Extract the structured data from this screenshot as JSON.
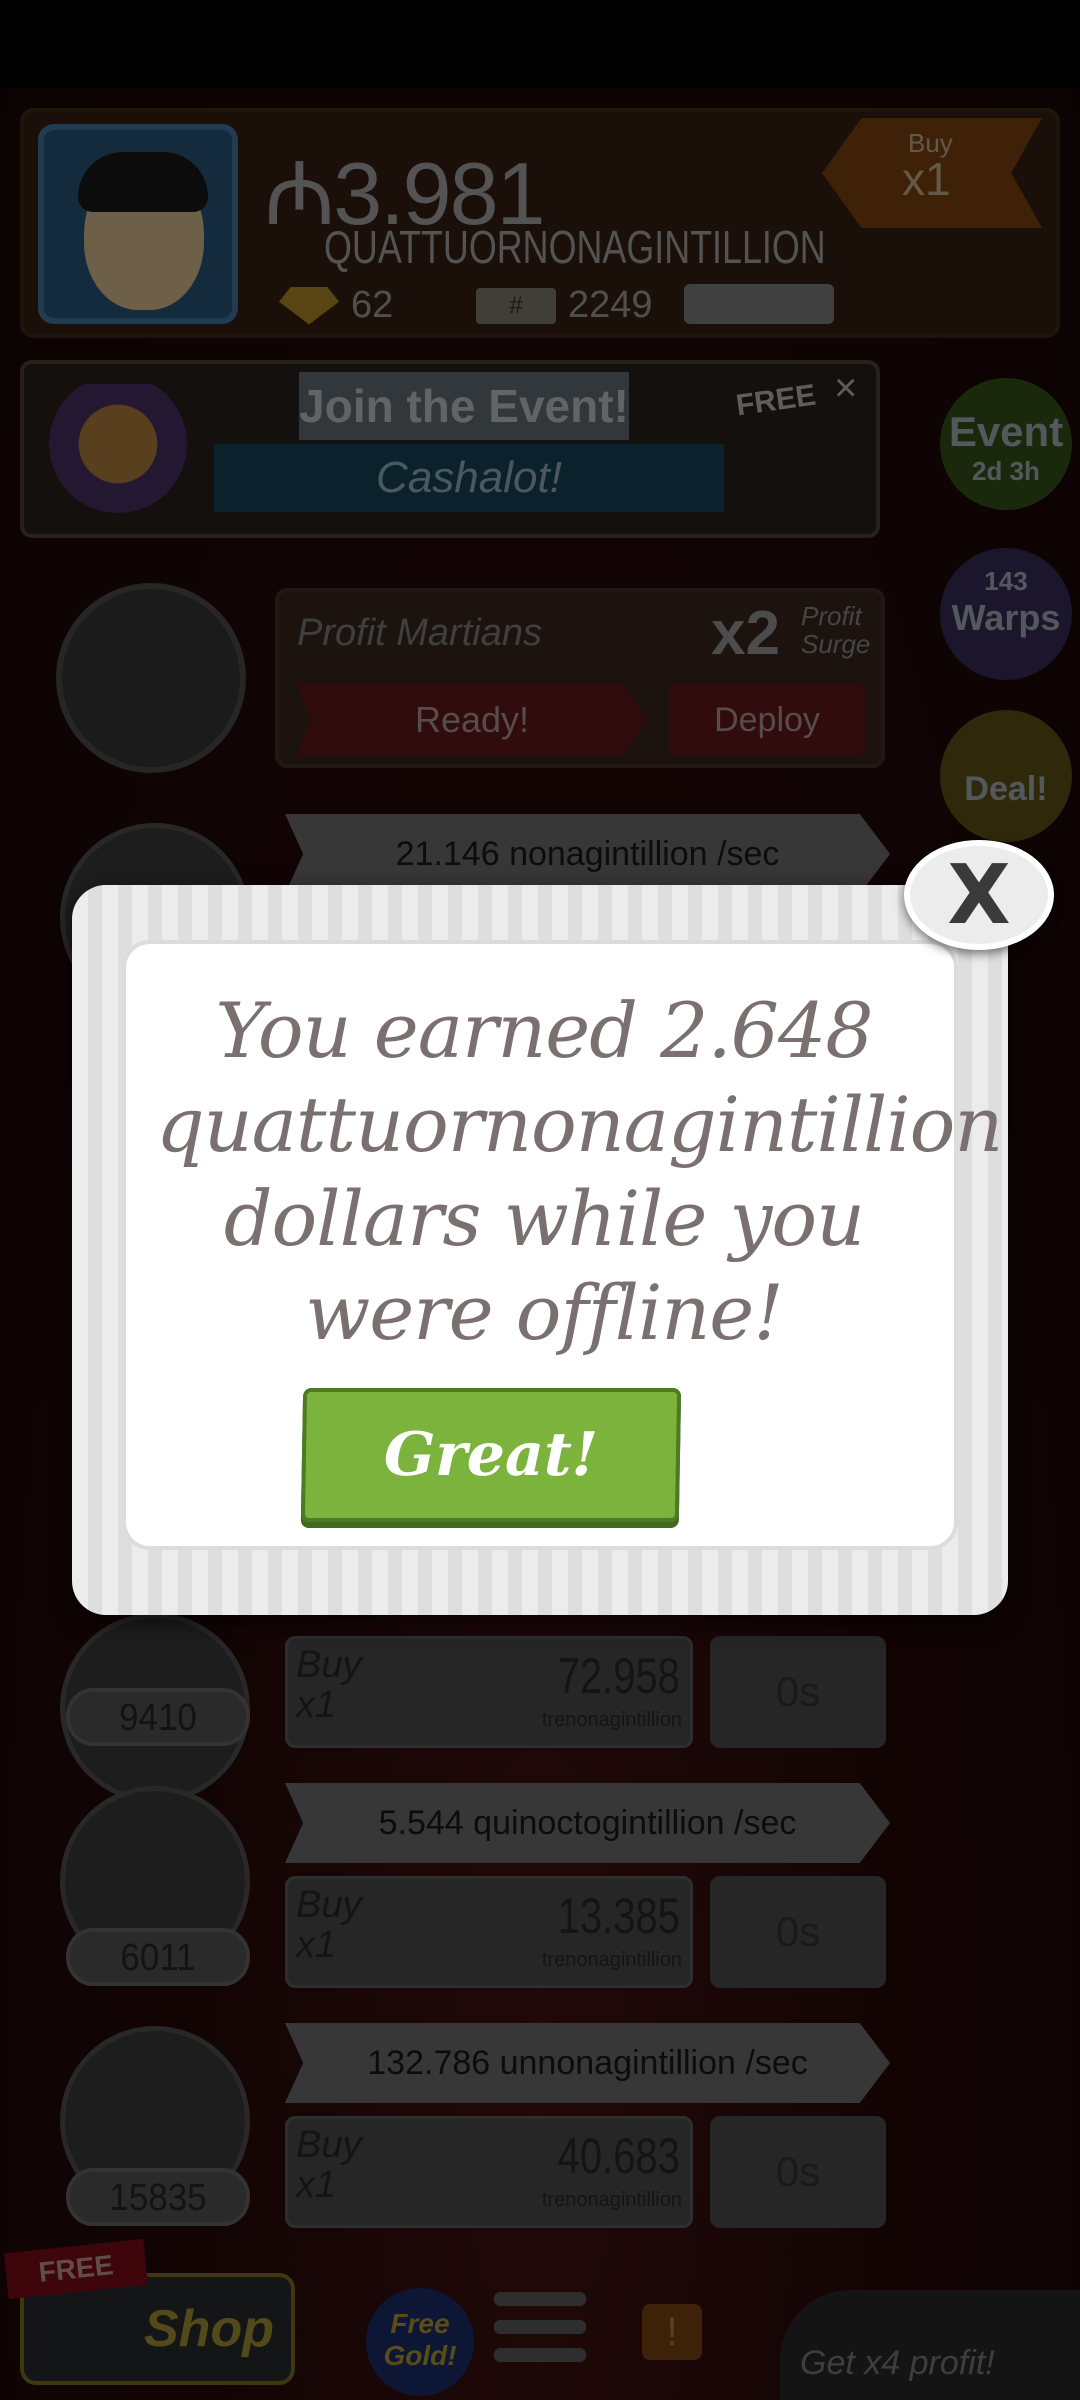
{
  "header": {
    "money_symbol": "₼",
    "money_value": "3.981",
    "money_unit": "QUATTUORNONAGINTILLION",
    "gold": "62",
    "ticket_label": "#",
    "tickets": "2249",
    "buy_tag_top": "Buy",
    "buy_tag_value": "x1"
  },
  "event": {
    "title": "Join the Event!",
    "subtitle": "Cashalot!",
    "free": "FREE",
    "close": "×"
  },
  "side": {
    "event_label": "Event",
    "event_time": "2d 3h",
    "warps_count": "143",
    "warps_label": "Warps",
    "deal_label": "Deal!"
  },
  "martians": {
    "title": "Profit Martians",
    "multiplier": "x2",
    "mult_label_1": "Profit",
    "mult_label_2": "Surge",
    "ready": "Ready!",
    "deploy": "Deploy"
  },
  "businesses": [
    {
      "income": "21.146 nonagintillion /sec"
    },
    {
      "count": "9410",
      "buy": "Buy",
      "qty": "x1",
      "cost": "72.958",
      "cost_unit": "trenonagintillion",
      "time": "0s"
    },
    {
      "income": "5.544 quinoctogintillion /sec",
      "count": "6011",
      "buy": "Buy",
      "qty": "x1",
      "cost": "13.385",
      "cost_unit": "trenonagintillion",
      "time": "0s"
    },
    {
      "income": "132.786 unnonagintillion /sec",
      "count": "15835",
      "buy": "Buy",
      "qty": "x1",
      "cost": "40.683",
      "cost_unit": "trenonagintillion",
      "time": "0s"
    }
  ],
  "bottom": {
    "free_ribbon": "FREE",
    "shop": "Shop",
    "free_gold": "Free Gold!",
    "x4": "Get x4 profit!"
  },
  "modal": {
    "message": "You earned 2.648 quattuornonagintillion dollars while you were offline!",
    "button": "Great!",
    "close": "X"
  }
}
